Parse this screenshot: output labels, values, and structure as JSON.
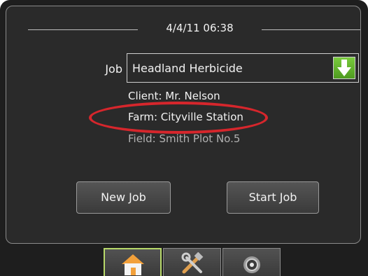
{
  "header": {
    "datetime": "4/4/11 06:38"
  },
  "job": {
    "label": "Job",
    "selected": "Headland Herbicide",
    "client": "Client: Mr. Nelson",
    "farm": "Farm: Cityville Station",
    "field": "Field: Smith Plot No.5"
  },
  "buttons": {
    "new_job": "New Job",
    "start_job": "Start Job"
  },
  "tabs": [
    {
      "icon": "home-icon",
      "active": true
    },
    {
      "icon": "tools-icon",
      "active": false
    },
    {
      "icon": "camera-icon",
      "active": false
    }
  ],
  "colors": {
    "background": "#2a2a2a",
    "highlight": "#d6262c",
    "dropdown_green": "#5fb22b",
    "active_tab_border": "#b8d96a"
  }
}
